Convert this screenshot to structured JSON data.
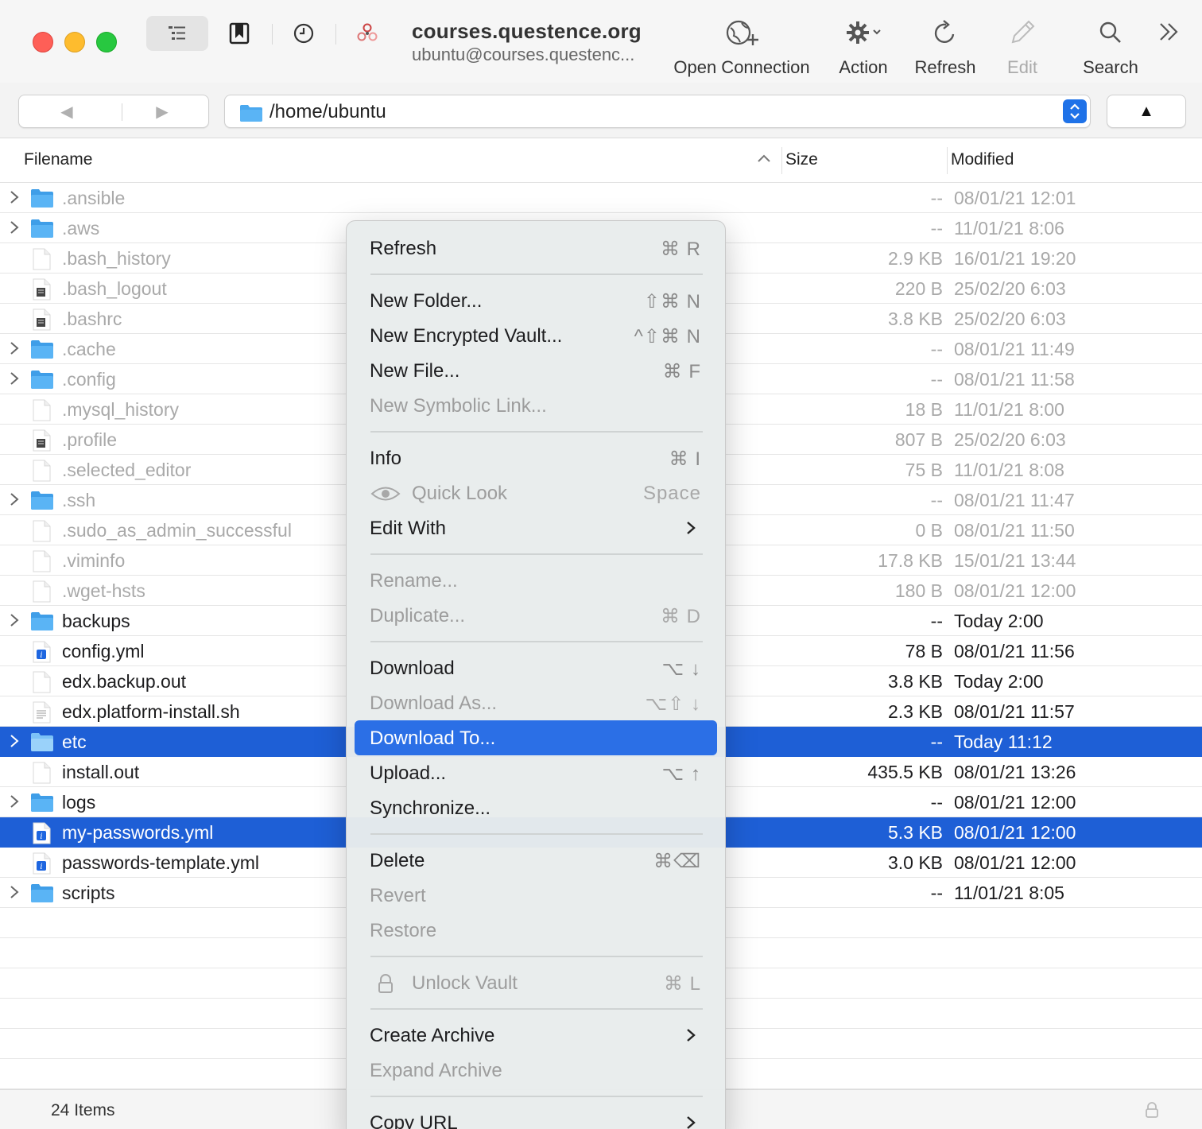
{
  "window": {
    "connection_title": "courses.questence.org",
    "connection_subtitle": "ubuntu@courses.questenc..."
  },
  "toolbar": {
    "open_connection": "Open Connection",
    "action": "Action",
    "refresh": "Refresh",
    "edit": "Edit",
    "search": "Search"
  },
  "pathbar": {
    "path": "/home/ubuntu",
    "back_glyph": "◀",
    "forward_glyph": "▶",
    "up_glyph": "▲"
  },
  "table": {
    "columns": {
      "filename": "Filename",
      "size": "Size",
      "modified": "Modified"
    },
    "rows": [
      {
        "name": ".ansible",
        "size": "--",
        "modified": "08/01/21 12:01",
        "kind": "folder",
        "hidden": true,
        "selected": false
      },
      {
        "name": ".aws",
        "size": "--",
        "modified": "11/01/21 8:06",
        "kind": "folder",
        "hidden": true,
        "selected": false
      },
      {
        "name": ".bash_history",
        "size": "2.9 KB",
        "modified": "16/01/21 19:20",
        "kind": "file",
        "hidden": true,
        "selected": false
      },
      {
        "name": ".bash_logout",
        "size": "220 B",
        "modified": "25/02/20 6:03",
        "kind": "script",
        "hidden": true,
        "selected": false
      },
      {
        "name": ".bashrc",
        "size": "3.8 KB",
        "modified": "25/02/20 6:03",
        "kind": "script",
        "hidden": true,
        "selected": false
      },
      {
        "name": ".cache",
        "size": "--",
        "modified": "08/01/21 11:49",
        "kind": "folder",
        "hidden": true,
        "selected": false
      },
      {
        "name": ".config",
        "size": "--",
        "modified": "08/01/21 11:58",
        "kind": "folder",
        "hidden": true,
        "selected": false
      },
      {
        "name": ".mysql_history",
        "size": "18 B",
        "modified": "11/01/21 8:00",
        "kind": "file",
        "hidden": true,
        "selected": false
      },
      {
        "name": ".profile",
        "size": "807 B",
        "modified": "25/02/20 6:03",
        "kind": "script",
        "hidden": true,
        "selected": false
      },
      {
        "name": ".selected_editor",
        "size": "75 B",
        "modified": "11/01/21 8:08",
        "kind": "file",
        "hidden": true,
        "selected": false
      },
      {
        "name": ".ssh",
        "size": "--",
        "modified": "08/01/21 11:47",
        "kind": "folder",
        "hidden": true,
        "selected": false
      },
      {
        "name": ".sudo_as_admin_successful",
        "size": "0 B",
        "modified": "08/01/21 11:50",
        "kind": "file",
        "hidden": true,
        "selected": false
      },
      {
        "name": ".viminfo",
        "size": "17.8 KB",
        "modified": "15/01/21 13:44",
        "kind": "file",
        "hidden": true,
        "selected": false
      },
      {
        "name": ".wget-hsts",
        "size": "180 B",
        "modified": "08/01/21 12:00",
        "kind": "file",
        "hidden": true,
        "selected": false
      },
      {
        "name": "backups",
        "size": "--",
        "modified": "Today 2:00",
        "kind": "folder",
        "hidden": false,
        "selected": false
      },
      {
        "name": "config.yml",
        "size": "78 B",
        "modified": "08/01/21 11:56",
        "kind": "yml",
        "hidden": false,
        "selected": false
      },
      {
        "name": "edx.backup.out",
        "size": "3.8 KB",
        "modified": "Today 2:00",
        "kind": "file",
        "hidden": false,
        "selected": false
      },
      {
        "name": "edx.platform-install.sh",
        "size": "2.3 KB",
        "modified": "08/01/21 11:57",
        "kind": "shell",
        "hidden": false,
        "selected": false
      },
      {
        "name": "etc",
        "size": "--",
        "modified": "Today 11:12",
        "kind": "folder",
        "hidden": false,
        "selected": true
      },
      {
        "name": "install.out",
        "size": "435.5 KB",
        "modified": "08/01/21 13:26",
        "kind": "file",
        "hidden": false,
        "selected": false
      },
      {
        "name": "logs",
        "size": "--",
        "modified": "08/01/21 12:00",
        "kind": "folder",
        "hidden": false,
        "selected": false
      },
      {
        "name": "my-passwords.yml",
        "size": "5.3 KB",
        "modified": "08/01/21 12:00",
        "kind": "yml",
        "hidden": false,
        "selected": true
      },
      {
        "name": "passwords-template.yml",
        "size": "3.0 KB",
        "modified": "08/01/21 12:00",
        "kind": "yml",
        "hidden": false,
        "selected": false
      },
      {
        "name": "scripts",
        "size": "--",
        "modified": "11/01/21 8:05",
        "kind": "folder",
        "hidden": false,
        "selected": false
      }
    ]
  },
  "status": {
    "item_count": "24 Items"
  },
  "context_menu": {
    "items": [
      {
        "label": "Refresh",
        "shortcut": "⌘ R",
        "disabled": false,
        "highlighted": false,
        "submenu": false,
        "icon": "",
        "sep_before": false
      },
      {
        "label": "New Folder...",
        "shortcut": "⇧⌘ N",
        "disabled": false,
        "highlighted": false,
        "submenu": false,
        "icon": "",
        "sep_before": true
      },
      {
        "label": "New Encrypted Vault...",
        "shortcut": "^⇧⌘ N",
        "disabled": false,
        "highlighted": false,
        "submenu": false,
        "icon": "",
        "sep_before": false
      },
      {
        "label": "New File...",
        "shortcut": "⌘ F",
        "disabled": false,
        "highlighted": false,
        "submenu": false,
        "icon": "",
        "sep_before": false
      },
      {
        "label": "New Symbolic Link...",
        "shortcut": "",
        "disabled": true,
        "highlighted": false,
        "submenu": false,
        "icon": "",
        "sep_before": false
      },
      {
        "label": "Info",
        "shortcut": "⌘ I",
        "disabled": false,
        "highlighted": false,
        "submenu": false,
        "icon": "",
        "sep_before": true
      },
      {
        "label": "Quick Look",
        "shortcut": "Space",
        "disabled": true,
        "highlighted": false,
        "submenu": false,
        "icon": "eye-icon",
        "sep_before": false
      },
      {
        "label": "Edit With",
        "shortcut": "",
        "disabled": false,
        "highlighted": false,
        "submenu": true,
        "icon": "",
        "sep_before": false
      },
      {
        "label": "Rename...",
        "shortcut": "",
        "disabled": true,
        "highlighted": false,
        "submenu": false,
        "icon": "",
        "sep_before": true
      },
      {
        "label": "Duplicate...",
        "shortcut": "⌘ D",
        "disabled": true,
        "highlighted": false,
        "submenu": false,
        "icon": "",
        "sep_before": false
      },
      {
        "label": "Download",
        "shortcut": "⌥ ↓",
        "disabled": false,
        "highlighted": false,
        "submenu": false,
        "icon": "",
        "sep_before": true
      },
      {
        "label": "Download As...",
        "shortcut": "⌥⇧ ↓",
        "disabled": true,
        "highlighted": false,
        "submenu": false,
        "icon": "",
        "sep_before": false
      },
      {
        "label": "Download To...",
        "shortcut": "",
        "disabled": false,
        "highlighted": true,
        "submenu": false,
        "icon": "",
        "sep_before": false
      },
      {
        "label": "Upload...",
        "shortcut": "⌥ ↑",
        "disabled": false,
        "highlighted": false,
        "submenu": false,
        "icon": "",
        "sep_before": false
      },
      {
        "label": "Synchronize...",
        "shortcut": "",
        "disabled": false,
        "highlighted": false,
        "submenu": false,
        "icon": "",
        "sep_before": false
      },
      {
        "label": "Delete",
        "shortcut": "⌘⌫",
        "disabled": false,
        "highlighted": false,
        "submenu": false,
        "icon": "",
        "sep_before": true
      },
      {
        "label": "Revert",
        "shortcut": "",
        "disabled": true,
        "highlighted": false,
        "submenu": false,
        "icon": "",
        "sep_before": false
      },
      {
        "label": "Restore",
        "shortcut": "",
        "disabled": true,
        "highlighted": false,
        "submenu": false,
        "icon": "",
        "sep_before": false
      },
      {
        "label": "Unlock Vault",
        "shortcut": "⌘ L",
        "disabled": true,
        "highlighted": false,
        "submenu": false,
        "icon": "lock-icon",
        "sep_before": true
      },
      {
        "label": "Create Archive",
        "shortcut": "",
        "disabled": false,
        "highlighted": false,
        "submenu": true,
        "icon": "",
        "sep_before": true
      },
      {
        "label": "Expand Archive",
        "shortcut": "",
        "disabled": true,
        "highlighted": false,
        "submenu": false,
        "icon": "",
        "sep_before": false
      },
      {
        "label": "Copy URL",
        "shortcut": "",
        "disabled": false,
        "highlighted": false,
        "submenu": true,
        "icon": "",
        "sep_before": true
      }
    ]
  },
  "colors": {
    "selection": "#1e5fd6",
    "menu_highlight": "#2b6fe6",
    "folder": "#4aa8ef",
    "close": "#fe5f57",
    "minimize": "#febc2e",
    "zoom": "#28c840"
  }
}
